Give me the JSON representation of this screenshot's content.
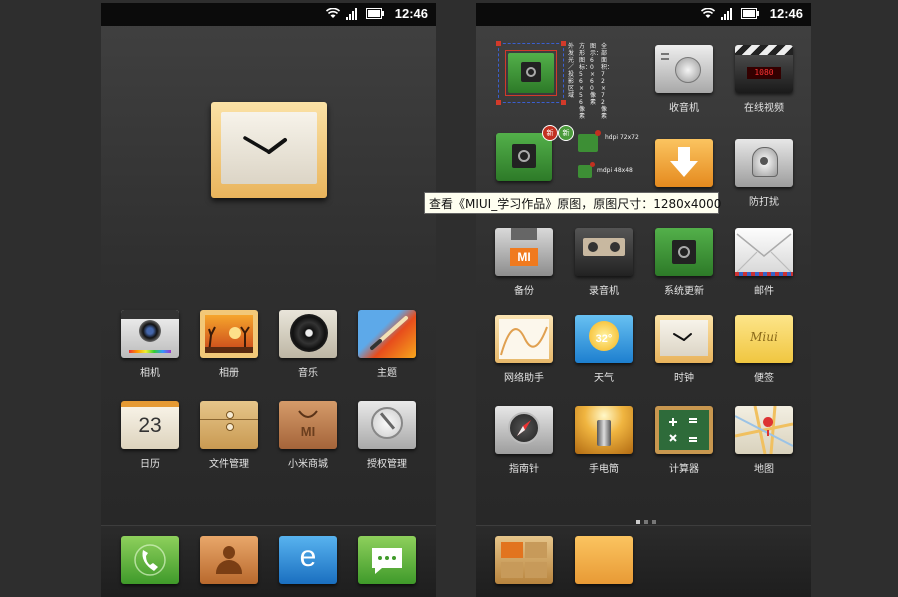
{
  "status_bar": {
    "time": "12:46",
    "icons": [
      "wifi-icon",
      "signal-icon",
      "battery-icon"
    ]
  },
  "left_screen": {
    "widget": "clock-widget",
    "apps": [
      {
        "label": "相机",
        "icon": "camera-icon"
      },
      {
        "label": "相册",
        "icon": "gallery-icon"
      },
      {
        "label": "音乐",
        "icon": "music-icon"
      },
      {
        "label": "主题",
        "icon": "theme-icon"
      },
      {
        "label": "日历",
        "icon": "calendar-icon",
        "value": "23"
      },
      {
        "label": "文件管理",
        "icon": "file-manager-icon"
      },
      {
        "label": "小米商城",
        "icon": "mi-store-icon",
        "value": "MI"
      },
      {
        "label": "授权管理",
        "icon": "permission-icon"
      }
    ],
    "dock": [
      {
        "icon": "phone-icon"
      },
      {
        "icon": "contacts-icon"
      },
      {
        "icon": "browser-icon",
        "value": "e"
      },
      {
        "icon": "messages-icon"
      }
    ]
  },
  "right_screen": {
    "annotations": {
      "col1": "外发光／投影区域",
      "col2": "方形图标：56×56像素",
      "col3": "图示：60×60像素",
      "col4": "全部面积：72×72像素",
      "hdpi": "hdpi 72x72",
      "mdpi": "mdpi 48x48",
      "badge": "新"
    },
    "apps": [
      {
        "label": "收音机",
        "icon": "radio-icon"
      },
      {
        "label": "在线视频",
        "icon": "video-icon",
        "value": "1080"
      },
      {
        "label": "",
        "icon": "download-icon"
      },
      {
        "label": "防打扰",
        "icon": "do-not-disturb-icon"
      },
      {
        "label": "备份",
        "icon": "backup-icon",
        "value": "MI"
      },
      {
        "label": "录音机",
        "icon": "recorder-icon"
      },
      {
        "label": "系统更新",
        "icon": "system-update-icon"
      },
      {
        "label": "邮件",
        "icon": "mail-icon"
      },
      {
        "label": "网络助手",
        "icon": "network-icon"
      },
      {
        "label": "天气",
        "icon": "weather-icon",
        "value": "32°"
      },
      {
        "label": "时钟",
        "icon": "clock-icon"
      },
      {
        "label": "便签",
        "icon": "notes-icon",
        "value": "Miui"
      },
      {
        "label": "指南针",
        "icon": "compass-icon"
      },
      {
        "label": "手电筒",
        "icon": "flashlight-icon"
      },
      {
        "label": "计算器",
        "icon": "calculator-icon"
      },
      {
        "label": "地图",
        "icon": "map-icon"
      }
    ],
    "dock": [
      {
        "icon": "gallery-folder-icon"
      },
      {
        "icon": "folder-icon"
      }
    ]
  },
  "tooltip": "查看《MIUI_学习作品》原图，原图尺寸：1280x4000"
}
